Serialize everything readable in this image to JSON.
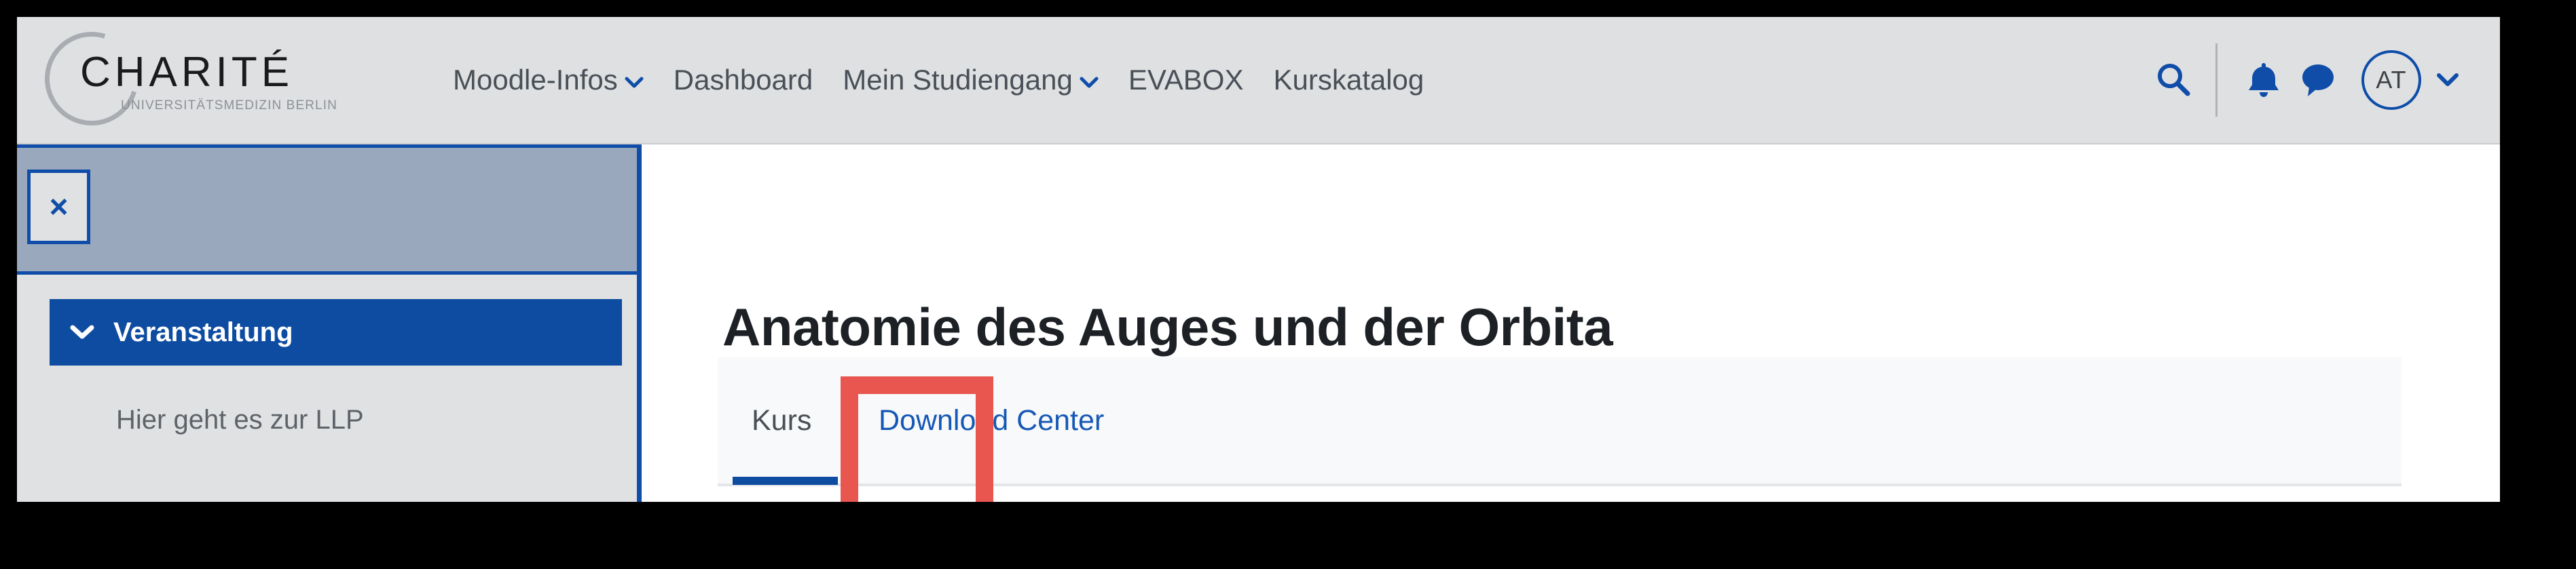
{
  "header": {
    "logo": {
      "wordmark": "CHARITÉ",
      "subtitle": "UNIVERSITÄTSMEDIZIN BERLIN",
      "arc_icon": "charite-c-arc-icon"
    },
    "nav_items": [
      {
        "label": "Moodle-Infos",
        "has_caret": true,
        "icon": "chevron-down-icon"
      },
      {
        "label": "Dashboard",
        "has_caret": false
      },
      {
        "label": "Mein Studiengang",
        "has_caret": true,
        "icon": "chevron-down-icon"
      },
      {
        "label": "EVABOX",
        "has_caret": false
      },
      {
        "label": "Kurskatalog",
        "has_caret": false
      }
    ],
    "tools": {
      "search_icon": "search-icon",
      "notifications_icon": "bell-icon",
      "messages_icon": "chat-bubble-icon",
      "avatar_initials": "AT",
      "avatar_caret_icon": "chevron-down-icon"
    }
  },
  "sidebar": {
    "close_label": "×",
    "section": {
      "label": "Veranstaltung",
      "caret_icon": "chevron-down-icon",
      "expanded": true
    },
    "links": [
      {
        "label": "Hier geht es zur LLP"
      }
    ]
  },
  "main": {
    "page_title": "Anatomie des Auges und der Orbita",
    "tabs": [
      {
        "label": "Kurs",
        "active": true
      },
      {
        "label": "Download Center",
        "active": false,
        "highlighted": true
      }
    ]
  },
  "colors": {
    "brand_blue": "#0e4ca1",
    "link_blue": "#1658b5",
    "header_bg": "#dee0e2",
    "sidebar_bg": "#e0e1e2",
    "drawer_header_bg": "#99a8bc",
    "tab_panel_bg": "#f8f9fa",
    "highlight_red": "#e9564f",
    "text_dark": "#1d2125",
    "text_muted": "#5d6369"
  }
}
